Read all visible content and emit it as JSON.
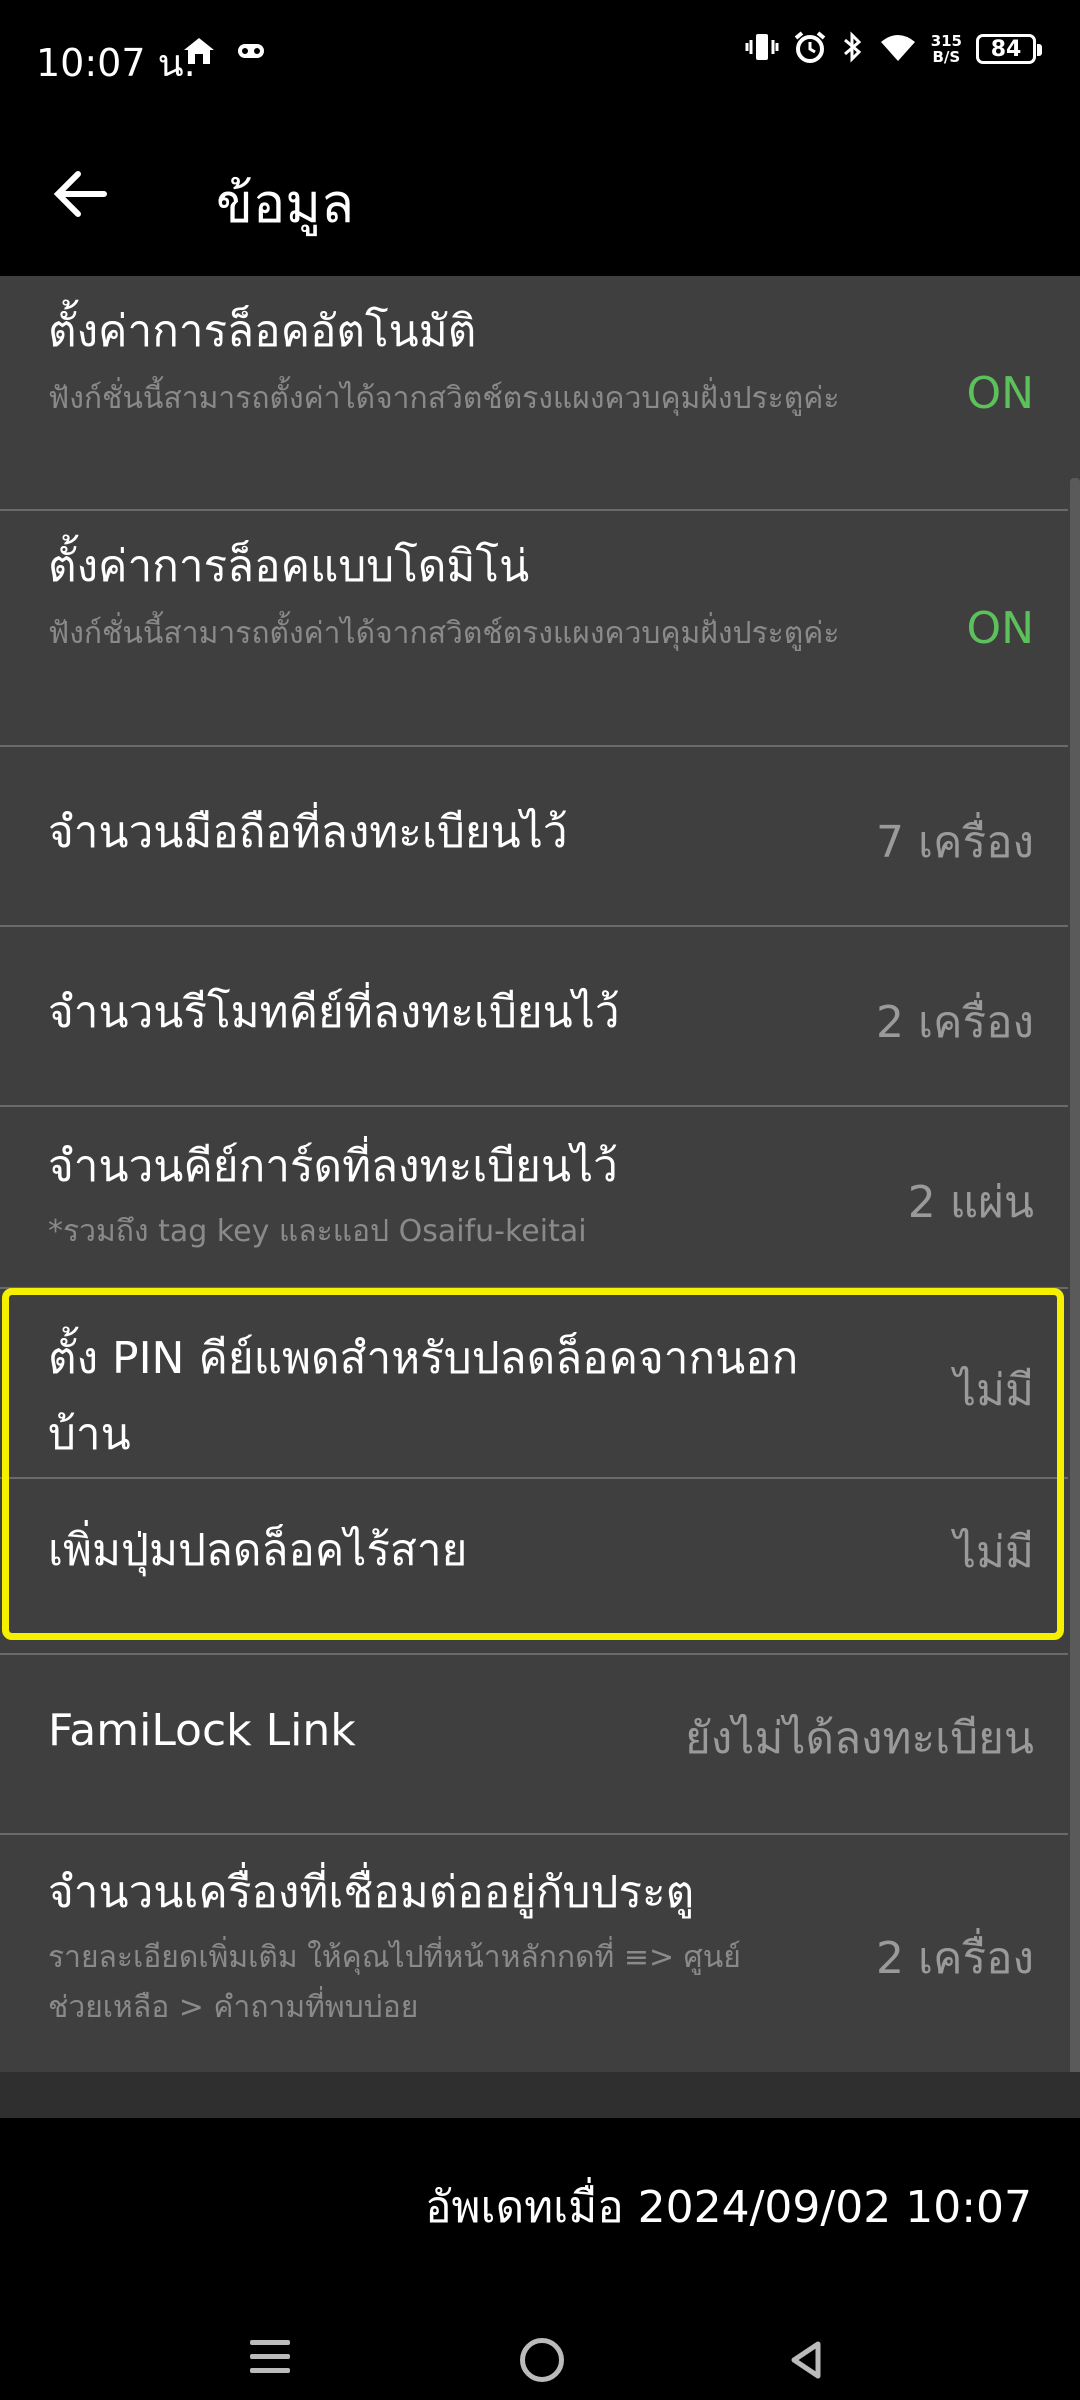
{
  "status_bar": {
    "time": "10:07 น.",
    "net_speed_top": "315",
    "net_speed_bottom": "B/S",
    "battery": "84"
  },
  "app_bar": {
    "title": "ข้อมูล"
  },
  "rows": [
    {
      "title": "ตั้งค่าการล็อคอัตโนมัติ",
      "desc": "ฟังก์ชั่นนี้สามารถตั้งค่าได้จากสวิตช์ตรงแผงควบคุมฝั่งประตูค่ะ",
      "value": "ON"
    },
    {
      "title": "ตั้งค่าการล็อคแบบโดมิโน่",
      "desc": "ฟังก์ชั่นนี้สามารถตั้งค่าได้จากสวิตช์ตรงแผงควบคุมฝั่งประตูค่ะ",
      "value": "ON"
    },
    {
      "title": "จำนวนมือถือที่ลงทะเบียนไว้",
      "value": "7 เครื่อง"
    },
    {
      "title": "จำนวนรีโมทคีย์ที่ลงทะเบียนไว้",
      "value": "2 เครื่อง"
    },
    {
      "title": "จำนวนคีย์การ์ดที่ลงทะเบียนไว้",
      "desc": "*รวมถึง tag key และแอป Osaifu-keitai",
      "value": "2 แผ่น"
    },
    {
      "title_line1": "ตั้ง PIN คีย์แพดสำหรับปลดล็อคจากนอก",
      "title_line2": "บ้าน",
      "value": "ไม่มี"
    },
    {
      "title": "เพิ่มปุ่มปลดล็อคไร้สาย",
      "value": "ไม่มี"
    },
    {
      "title": "FamiLock Link",
      "value": "ยังไม่ได้ลงทะเบียน"
    },
    {
      "title": "จำนวนเครื่องที่เชื่อมต่ออยู่กับประตู",
      "desc_line1": "รายละเอียดเพิ่มเติม ให้คุณไปที่หน้าหลักกดที่ ≡> ศูนย์",
      "desc_line2": "ช่วยเหลือ > คำถามที่พบบ่อย",
      "value": "2 เครื่อง"
    }
  ],
  "footer": {
    "updated": "อัพเดทเมื่อ 2024/09/02 10:07"
  },
  "colors": {
    "on_green": "#5cc15a",
    "highlight": "#f5f000",
    "list_bg": "#3f3f3f"
  }
}
